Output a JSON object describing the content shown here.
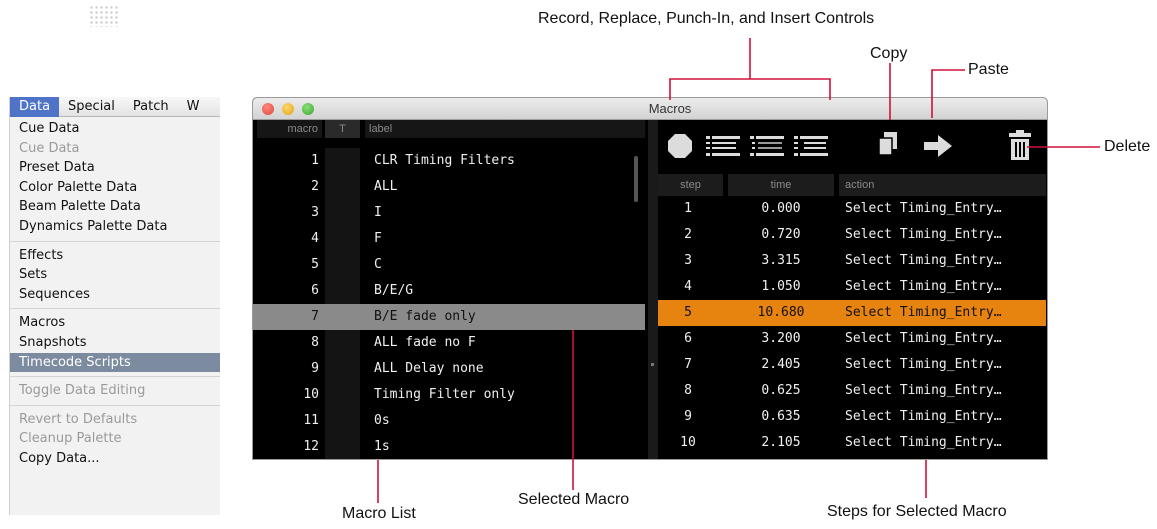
{
  "menu": {
    "bar": [
      "Data",
      "Special",
      "Patch",
      "W"
    ],
    "items": [
      {
        "label": "Cue Data",
        "state": "normal"
      },
      {
        "label": "Cue Data",
        "state": "disabled"
      },
      {
        "label": "Preset Data",
        "state": "normal"
      },
      {
        "label": "Color Palette Data",
        "state": "normal"
      },
      {
        "label": "Beam Palette Data",
        "state": "normal"
      },
      {
        "label": "Dynamics Palette Data",
        "state": "normal"
      },
      {
        "label": "Effects",
        "state": "normal"
      },
      {
        "label": "Sets",
        "state": "normal"
      },
      {
        "label": "Sequences",
        "state": "normal"
      },
      {
        "label": "Macros",
        "state": "normal"
      },
      {
        "label": "Snapshots",
        "state": "normal"
      },
      {
        "label": "Timecode Scripts",
        "state": "highlight"
      },
      {
        "label": "Toggle Data Editing",
        "state": "disabled"
      },
      {
        "label": "Revert to Defaults",
        "state": "disabled"
      },
      {
        "label": "Cleanup Palette",
        "state": "disabled"
      },
      {
        "label": "Copy Data...",
        "state": "normal"
      }
    ]
  },
  "window": {
    "title": "Macros",
    "macro_headers": {
      "num": "macro",
      "t": "T",
      "label": "label"
    },
    "macros": [
      {
        "num": "1",
        "label": "CLR Timing Filters"
      },
      {
        "num": "2",
        "label": "ALL"
      },
      {
        "num": "3",
        "label": "I"
      },
      {
        "num": "4",
        "label": "F"
      },
      {
        "num": "5",
        "label": "C"
      },
      {
        "num": "6",
        "label": "B/E/G"
      },
      {
        "num": "7",
        "label": "B/E fade only"
      },
      {
        "num": "8",
        "label": "ALL fade no F"
      },
      {
        "num": "9",
        "label": "ALL Delay none"
      },
      {
        "num": "10",
        "label": "Timing Filter only"
      },
      {
        "num": "11",
        "label": "0s"
      },
      {
        "num": "12",
        "label": "1s"
      }
    ],
    "selected_macro": "7",
    "step_headers": {
      "step": "step",
      "time": "time",
      "action": "action"
    },
    "steps": [
      {
        "step": "1",
        "time": "0.000",
        "action": "Select Timing_Entry…"
      },
      {
        "step": "2",
        "time": "0.720",
        "action": "Select Timing_Entry…"
      },
      {
        "step": "3",
        "time": "3.315",
        "action": "Select Timing_Entry…"
      },
      {
        "step": "4",
        "time": "1.050",
        "action": "Select Timing_Entry…"
      },
      {
        "step": "5",
        "time": "10.680",
        "action": "Select Timing_Entry…"
      },
      {
        "step": "6",
        "time": "3.200",
        "action": "Select Timing_Entry…"
      },
      {
        "step": "7",
        "time": "2.405",
        "action": "Select Timing_Entry…"
      },
      {
        "step": "8",
        "time": "0.625",
        "action": "Select Timing_Entry…"
      },
      {
        "step": "9",
        "time": "0.635",
        "action": "Select Timing_Entry…"
      },
      {
        "step": "10",
        "time": "2.105",
        "action": "Select Timing_Entry…"
      }
    ],
    "selected_step": "5",
    "toolbar_icons": [
      "record-icon",
      "replace-icon",
      "punch-in-icon",
      "insert-icon",
      "copy-icon",
      "paste-icon",
      "delete-icon"
    ]
  },
  "callouts": {
    "record_controls": "Record, Replace, Punch-In, and Insert Controls",
    "copy": "Copy",
    "paste": "Paste",
    "delete": "Delete",
    "macro_list": "Macro List",
    "selected_macro": "Selected Macro",
    "steps": "Steps for Selected Macro"
  },
  "colors": {
    "selected_step": "#e7830f",
    "selected_macro": "#8a8a8a",
    "callout_line": "#d0103a",
    "menu_active": "#4f74c7",
    "menu_highlight": "#7d8ba1"
  }
}
